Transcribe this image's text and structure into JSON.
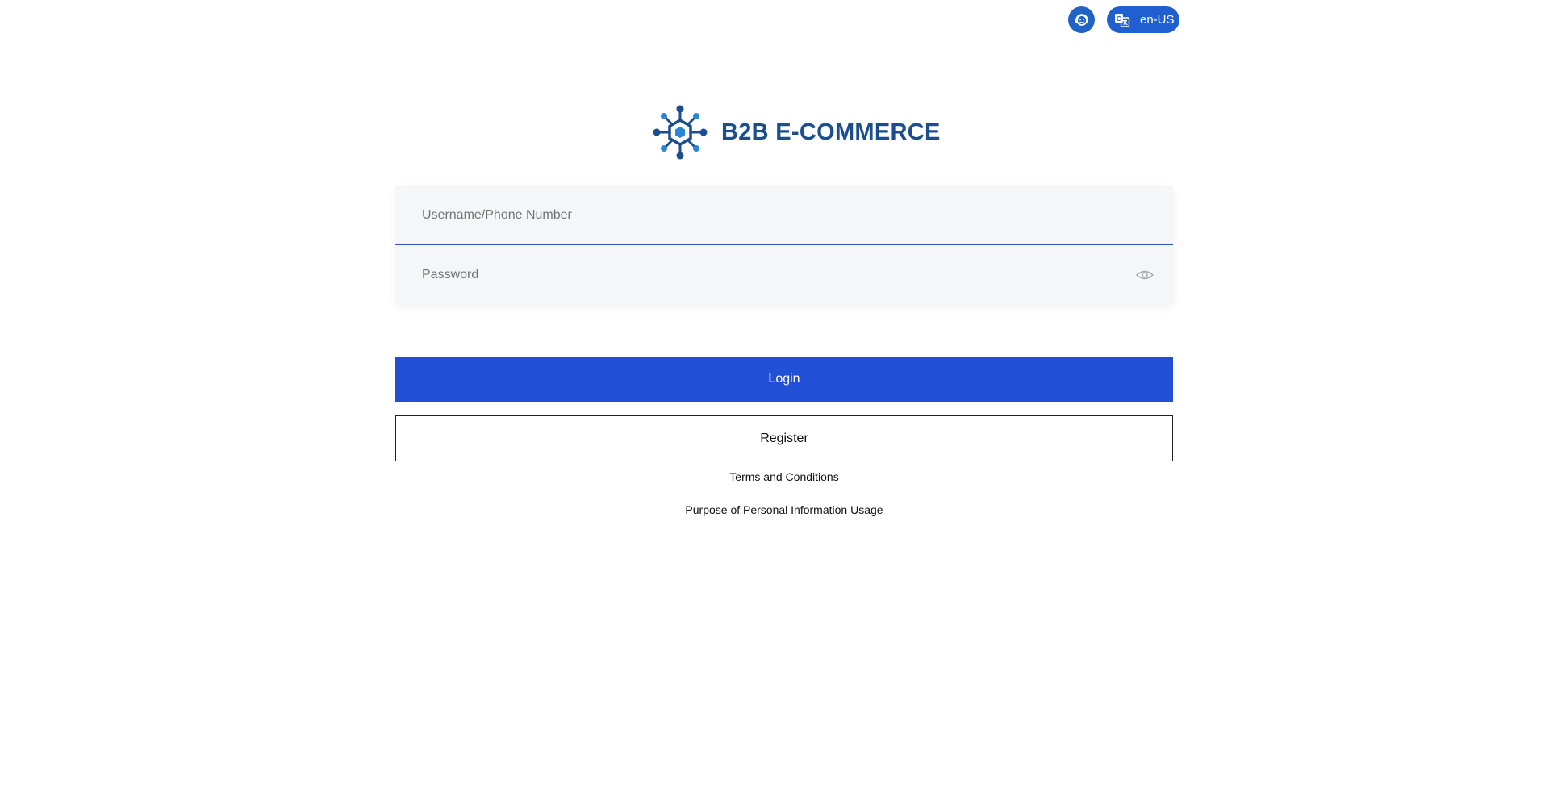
{
  "header": {
    "support_icon": "customer-service-icon",
    "language": {
      "icon": "translate-icon",
      "label": "en-US"
    }
  },
  "brand": {
    "name": "B2B E-COMMERCE",
    "logo_icon": "hexagon-network-icon",
    "color": "#1b4d8f"
  },
  "form": {
    "username_placeholder": "Username/Phone Number",
    "password_placeholder": "Password",
    "password_toggle_icon": "eye-icon"
  },
  "actions": {
    "login_label": "Login",
    "register_label": "Register"
  },
  "links": {
    "terms": "Terms and Conditions",
    "privacy": "Purpose of Personal Information Usage"
  },
  "colors": {
    "primary": "#2150d6",
    "header_button": "#1f63c7",
    "field_background": "#f5f6f7"
  }
}
